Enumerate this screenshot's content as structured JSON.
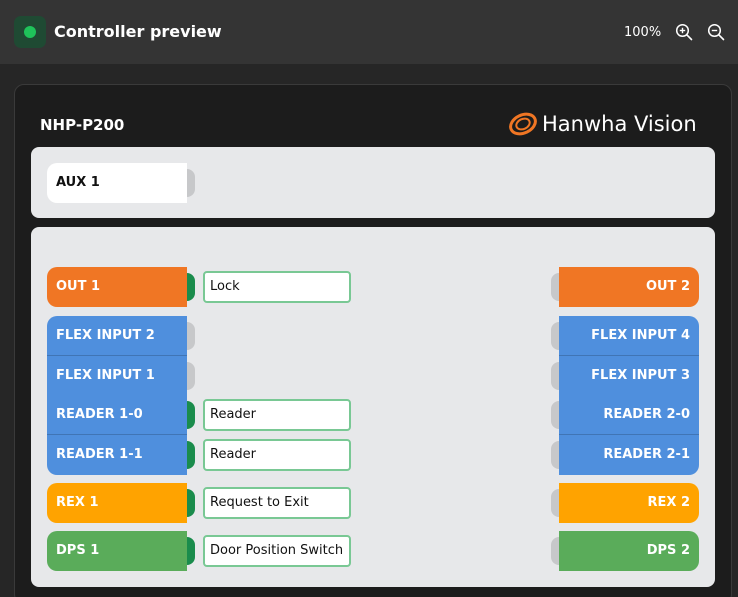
{
  "header": {
    "title": "Controller preview",
    "zoom_level": "100%",
    "status_color": "#1fc25a"
  },
  "device": {
    "model": "NHP-P200",
    "brand": "Hanwha Vision"
  },
  "aux": {
    "label": "AUX 1"
  },
  "left_ports": {
    "out1": "OUT 1",
    "flex2": "FLEX INPUT 2",
    "flex1": "FLEX INPUT 1",
    "reader10": "READER 1-0",
    "reader11": "READER 1-1",
    "rex1": "REX 1",
    "dps1": "DPS 1"
  },
  "right_ports": {
    "out2": "OUT 2",
    "flex4": "FLEX INPUT 4",
    "flex3": "FLEX INPUT 3",
    "reader20": "READER 2-0",
    "reader21": "READER 2-1",
    "rex2": "REX 2",
    "dps2": "DPS 2"
  },
  "assignments": {
    "out1": "Lock",
    "reader10": "Reader",
    "reader11": "Reader",
    "rex1": "Request to Exit",
    "dps1": "Door Position Switch"
  },
  "colors": {
    "output": "#f07624",
    "input": "#4f8fdd",
    "rex": "#ffa300",
    "dps": "#5aac5a",
    "connected": "#1a8c4c"
  },
  "icons": [
    "status-indicator",
    "zoom-in-icon",
    "zoom-out-icon",
    "hanwha-logo-icon"
  ]
}
